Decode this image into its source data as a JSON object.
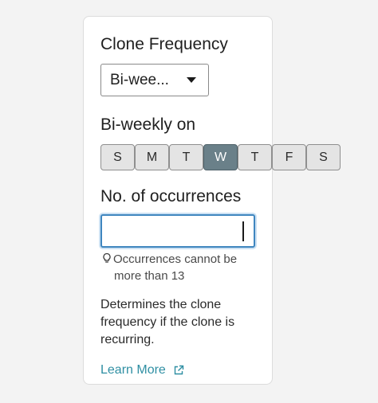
{
  "panel": {
    "frequency_title": "Clone Frequency",
    "frequency_select": {
      "selected": "Bi-wee..."
    },
    "weekly_title": "Bi-weekly on",
    "days": [
      {
        "label": "S",
        "selected": false
      },
      {
        "label": "M",
        "selected": false
      },
      {
        "label": "T",
        "selected": false
      },
      {
        "label": "W",
        "selected": true
      },
      {
        "label": "T",
        "selected": false
      },
      {
        "label": "F",
        "selected": false
      },
      {
        "label": "S",
        "selected": false
      }
    ],
    "occurrences_title": "No. of occurrences",
    "occurrences_value": "",
    "hint_line1": "Occurrences cannot be",
    "hint_line2": "more than 13",
    "description": "Determines the clone frequency if the clone is recurring.",
    "learn_more": "Learn More"
  },
  "colors": {
    "selected_day": "#6a8089",
    "link": "#2f8fa3",
    "focus_border": "#3f86bf"
  },
  "icons": {
    "dropdown": "caret-down-icon",
    "hint": "lightbulb-icon",
    "link": "external-link-icon"
  }
}
